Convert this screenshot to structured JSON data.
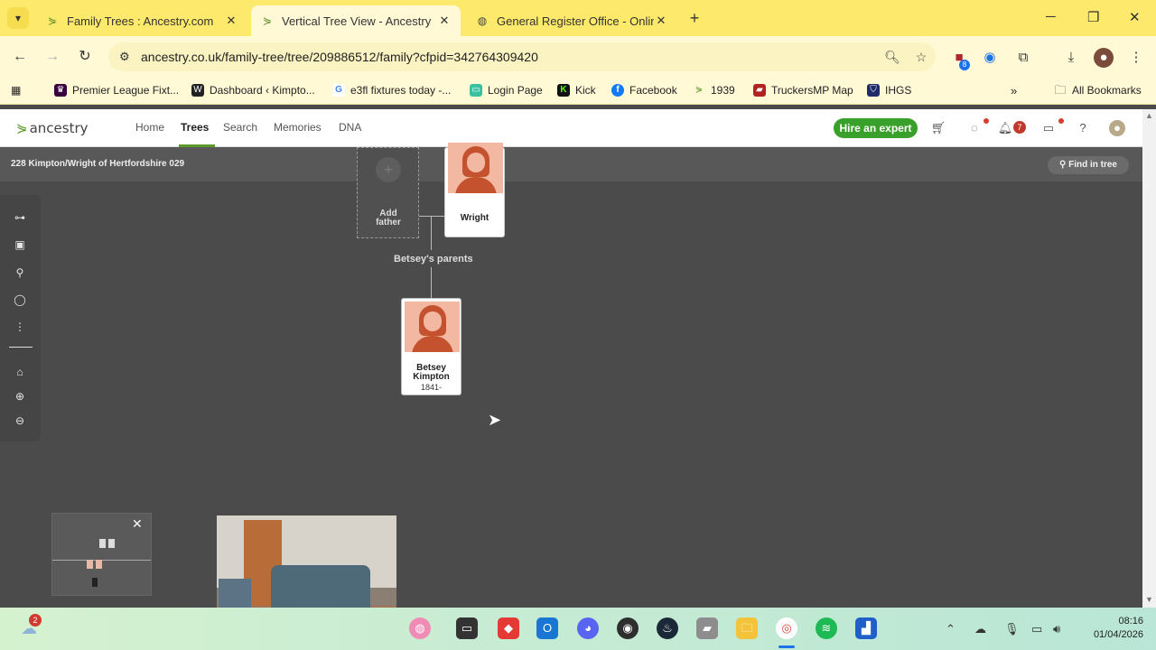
{
  "browser": {
    "tabs": [
      {
        "title": "Family Trees : Ancestry.com",
        "favicon": "ancestry-leaf-icon",
        "active": false
      },
      {
        "title": "Vertical Tree View - Ancestry",
        "favicon": "ancestry-leaf-icon",
        "active": true
      },
      {
        "title": "General Register Office - Online",
        "favicon": "globe-icon",
        "active": false
      }
    ],
    "url": "ancestry.co.uk/family-tree/tree/209886512/family?cfpid=342764309420",
    "extension_badge": "8",
    "bookmarks": [
      {
        "label": "Premier League Fixt...",
        "icon": "premier-league-icon",
        "color": "#38003c"
      },
      {
        "label": "Dashboard ‹ Kimpto...",
        "icon": "wordpress-icon",
        "color": "#222222"
      },
      {
        "label": "e3fl fixtures today -...",
        "icon": "google-icon",
        "color": "#4285f4"
      },
      {
        "label": "Login Page",
        "icon": "login-icon",
        "color": "#3cc1a0"
      },
      {
        "label": "Kick",
        "icon": "kick-icon",
        "color": "#53fc18"
      },
      {
        "label": "Facebook",
        "icon": "facebook-icon",
        "color": "#1877f2"
      },
      {
        "label": "1939",
        "icon": "ancestry-leaf-icon",
        "color": "#5b9a2a"
      },
      {
        "label": "TruckersMP Map",
        "icon": "truck-icon",
        "color": "#b22222"
      },
      {
        "label": "IHGS",
        "icon": "shield-icon",
        "color": "#1f2a6b"
      }
    ],
    "all_bookmarks": "All Bookmarks"
  },
  "ancestry": {
    "logo": "ancestry",
    "nav": [
      "Home",
      "Trees",
      "Search",
      "Memories",
      "DNA"
    ],
    "active_nav": "Trees",
    "hire_expert": "Hire an expert",
    "notifications_count": "7",
    "tree_name": "228 Kimpton/Wright of Hertfordshire 029",
    "find_in_tree": "Find in tree"
  },
  "tree": {
    "add_father_label": "Add father",
    "mother_name": "Wright",
    "parents_label": "Betsey's parents",
    "person": {
      "first": "Betsey",
      "last": "Kimpton",
      "dates": "1841-"
    }
  },
  "taskbar": {
    "weather_badge": "2",
    "time": "08:16",
    "date": "01/04/2026"
  },
  "colors": {
    "accent_green": "#3aa02c",
    "tab_strip": "#fde96b",
    "canvas": "#4b4b4b",
    "portrait": "#f2b8a1"
  }
}
